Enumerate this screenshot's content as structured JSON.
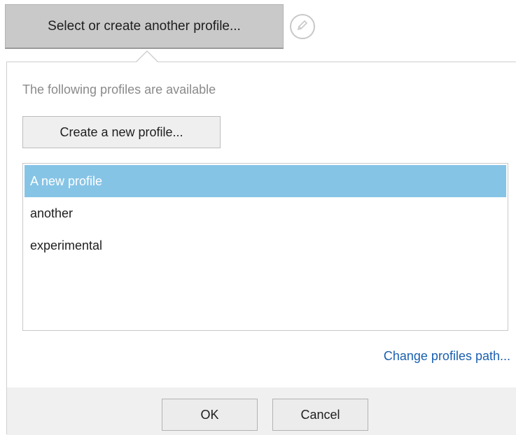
{
  "trigger": {
    "label": "Select or create another profile..."
  },
  "edit_icon": {
    "icon": "pencil-icon"
  },
  "panel": {
    "info_text": "The following profiles are available",
    "create_button_label": "Create a new profile...",
    "profiles": [
      {
        "name": "A new profile",
        "selected": true
      },
      {
        "name": "another",
        "selected": false
      },
      {
        "name": "experimental",
        "selected": false
      }
    ],
    "change_path_link": "Change profiles path..."
  },
  "footer": {
    "ok_label": "OK",
    "cancel_label": "Cancel"
  },
  "colors": {
    "selection": "#86c4e6",
    "link": "#1a5fb0",
    "trigger_bg": "#c9c9c9"
  }
}
